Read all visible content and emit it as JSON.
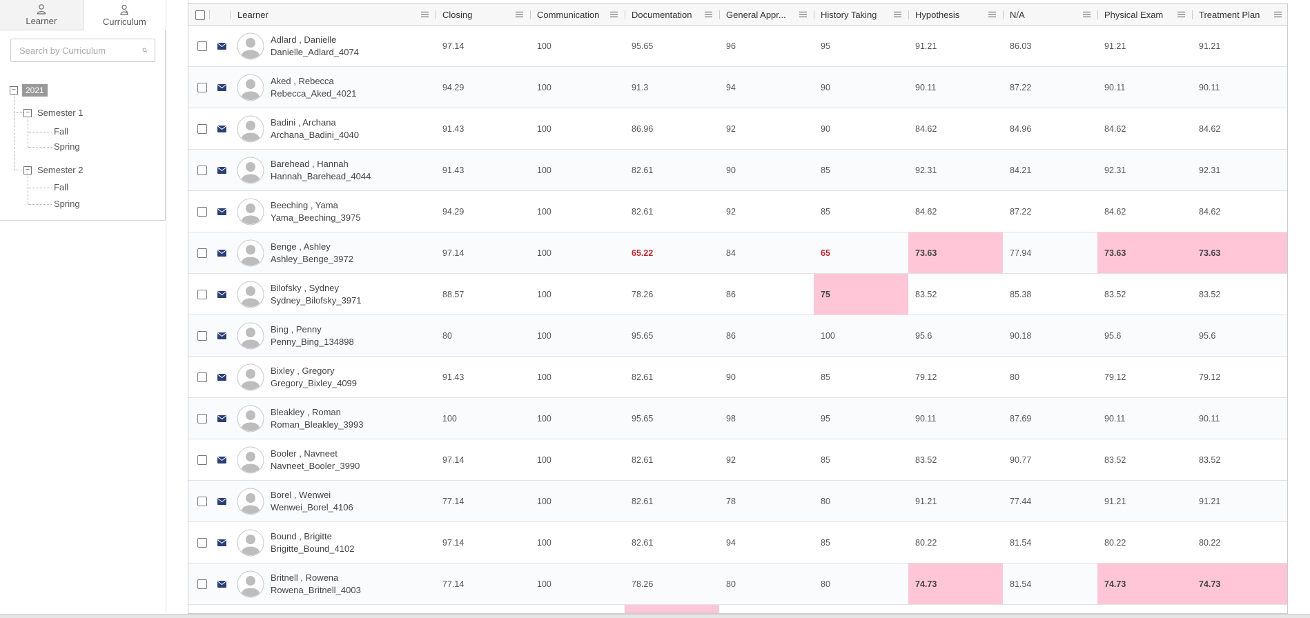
{
  "left_panel": {
    "tabs": [
      {
        "label": "Learner",
        "icon": "person-icon",
        "active": false
      },
      {
        "label": "Curriculum",
        "icon": "curriculum-icon",
        "active": true
      }
    ],
    "search_placeholder": "Search by Curriculum",
    "tree": {
      "year": "2021",
      "semester1": "Semester 1",
      "semester2": "Semester 2",
      "fall": "Fall",
      "spring": "Spring"
    }
  },
  "grid": {
    "columns": [
      {
        "key": "learner",
        "label": "Learner"
      },
      {
        "key": "closing",
        "label": "Closing"
      },
      {
        "key": "communication",
        "label": "Communication"
      },
      {
        "key": "documentation",
        "label": "Documentation"
      },
      {
        "key": "general",
        "label": "General Appr..."
      },
      {
        "key": "history",
        "label": "History Taking"
      },
      {
        "key": "hypothesis",
        "label": "Hypothesis"
      },
      {
        "key": "na",
        "label": "N/A"
      },
      {
        "key": "physical",
        "label": "Physical Exam"
      },
      {
        "key": "treatment",
        "label": "Treatment Plan"
      }
    ],
    "colors": {
      "highlight": "#ffc6d8",
      "low_text": "#c0272d",
      "mail": "#2b3f74"
    },
    "rows": [
      {
        "name": "Adlard , Danielle",
        "username": "Danielle_Adlard_4074",
        "values": [
          "97.14",
          "100",
          "95.65",
          "96",
          "95",
          "91.21",
          "86.03",
          "91.21",
          "91.21"
        ]
      },
      {
        "name": "Aked , Rebecca",
        "username": "Rebecca_Aked_4021",
        "values": [
          "94.29",
          "100",
          "91.3",
          "94",
          "90",
          "90.11",
          "87.22",
          "90.11",
          "90.11"
        ]
      },
      {
        "name": "Badini , Archana",
        "username": "Archana_Badini_4040",
        "values": [
          "91.43",
          "100",
          "86.96",
          "92",
          "90",
          "84.62",
          "84.96",
          "84.62",
          "84.62"
        ]
      },
      {
        "name": "Barehead , Hannah",
        "username": "Hannah_Barehead_4044",
        "values": [
          "91.43",
          "100",
          "82.61",
          "90",
          "85",
          "92.31",
          "84.21",
          "92.31",
          "92.31"
        ]
      },
      {
        "name": "Beeching , Yama",
        "username": "Yama_Beeching_3975",
        "values": [
          "94.29",
          "100",
          "82.61",
          "92",
          "85",
          "84.62",
          "87.22",
          "84.62",
          "84.62"
        ]
      },
      {
        "name": "Benge , Ashley",
        "username": "Ashley_Benge_3972",
        "values": [
          "97.14",
          "100",
          "65.22",
          "84",
          "65",
          "73.63",
          "77.94",
          "73.63",
          "73.63"
        ],
        "red": [
          2,
          4
        ],
        "highlight": [
          5,
          7,
          8
        ]
      },
      {
        "name": "Bilofsky , Sydney",
        "username": "Sydney_Bilofsky_3971",
        "values": [
          "88.57",
          "100",
          "78.26",
          "86",
          "75",
          "83.52",
          "85.38",
          "83.52",
          "83.52"
        ],
        "highlight": [
          4
        ]
      },
      {
        "name": "Bing , Penny",
        "username": "Penny_Bing_134898",
        "values": [
          "80",
          "100",
          "95.65",
          "86",
          "100",
          "95.6",
          "90.18",
          "95.6",
          "95.6"
        ]
      },
      {
        "name": "Bixley , Gregory",
        "username": "Gregory_Bixley_4099",
        "values": [
          "91.43",
          "100",
          "82.61",
          "90",
          "85",
          "79.12",
          "80",
          "79.12",
          "79.12"
        ]
      },
      {
        "name": "Bleakley , Roman",
        "username": "Roman_Bleakley_3993",
        "values": [
          "100",
          "100",
          "95.65",
          "98",
          "95",
          "90.11",
          "87.69",
          "90.11",
          "90.11"
        ]
      },
      {
        "name": "Booler , Navneet",
        "username": "Navneet_Booler_3990",
        "values": [
          "97.14",
          "100",
          "82.61",
          "92",
          "85",
          "83.52",
          "90.77",
          "83.52",
          "83.52"
        ]
      },
      {
        "name": "Borel , Wenwei",
        "username": "Wenwei_Borel_4106",
        "values": [
          "77.14",
          "100",
          "82.61",
          "78",
          "80",
          "91.21",
          "77.44",
          "91.21",
          "91.21"
        ]
      },
      {
        "name": "Bound , Brigitte",
        "username": "Brigitte_Bound_4102",
        "values": [
          "97.14",
          "100",
          "82.61",
          "94",
          "85",
          "80.22",
          "81.54",
          "80.22",
          "80.22"
        ]
      },
      {
        "name": "Britnell , Rowena",
        "username": "Rowena_Britnell_4003",
        "values": [
          "77.14",
          "100",
          "78.26",
          "80",
          "80",
          "74.73",
          "81.54",
          "74.73",
          "74.73"
        ],
        "highlight": [
          5,
          7,
          8
        ]
      },
      {
        "name": "",
        "username": "",
        "values": [
          "",
          "",
          "",
          "",
          "",
          "",
          "",
          "",
          ""
        ],
        "highlight": [
          2
        ],
        "partial": true
      }
    ]
  }
}
